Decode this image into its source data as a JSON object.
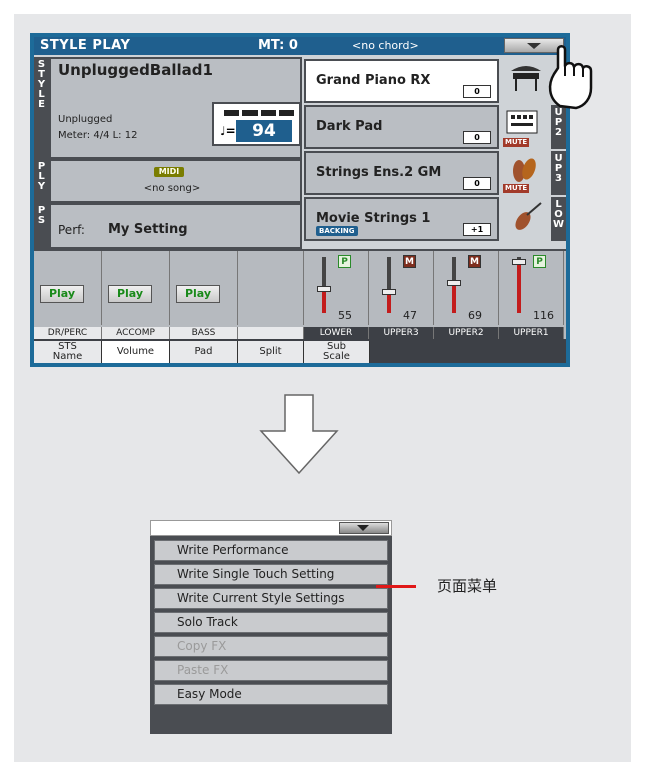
{
  "display": {
    "mode_title": "STYLE PLAY",
    "mt": "MT: 0",
    "chord": "<no chord>",
    "style": {
      "tab": "S\nT\nY\nL\nE",
      "name": "UnpluggedBallad1",
      "bank": "Unplugged",
      "meter": "Meter: 4/4  L: 12",
      "tempo_note": "♩=",
      "tempo": "94"
    },
    "player": {
      "tab": "P\nL\nY",
      "midi": "MIDI",
      "song": "<no song>"
    },
    "performance": {
      "tab": "P\nS",
      "label": "Perf:",
      "name": "My Setting"
    },
    "sounds": [
      {
        "name": "Grand Piano RX",
        "octave": "0",
        "side": "",
        "tag": "",
        "mute": ""
      },
      {
        "name": "Dark Pad",
        "octave": "0",
        "side": "U\nP\n2",
        "tag": "",
        "mute": "MUTE"
      },
      {
        "name": "Strings Ens.2 GM",
        "octave": "0",
        "side": "U\nP\n3",
        "tag": "",
        "mute": "MUTE"
      },
      {
        "name": "Movie Strings 1",
        "octave": "+1",
        "side": "L\nO\nW",
        "tag": "BACKING",
        "mute": ""
      }
    ],
    "mixer": {
      "channels": [
        {
          "label": "DR/PERC",
          "button": "Play"
        },
        {
          "label": "ACCOMP",
          "button": "Play"
        },
        {
          "label": "BASS",
          "button": "Play"
        },
        {
          "label": "",
          "button": ""
        }
      ],
      "keyboard": [
        {
          "label": "LOWER",
          "badge": "P",
          "volume": "55",
          "level": 0.43
        },
        {
          "label": "UPPER3",
          "badge": "M",
          "volume": "47",
          "level": 0.37
        },
        {
          "label": "UPPER2",
          "badge": "M",
          "volume": "69",
          "level": 0.54
        },
        {
          "label": "UPPER1",
          "badge": "P",
          "volume": "116",
          "level": 0.91
        }
      ]
    },
    "tabs": [
      "STS\nName",
      "Volume",
      "Pad",
      "Split",
      "Sub\nScale"
    ]
  },
  "menu": {
    "items": [
      {
        "label": "Write Performance",
        "enabled": true
      },
      {
        "label": "Write Single Touch Setting",
        "enabled": true
      },
      {
        "label": "Write Current Style Settings",
        "enabled": true
      },
      {
        "label": "Solo Track",
        "enabled": true
      },
      {
        "label": "Copy FX",
        "enabled": false
      },
      {
        "label": "Paste FX",
        "enabled": false
      },
      {
        "label": "Easy Mode",
        "enabled": true
      }
    ],
    "callout": "页面菜单"
  },
  "colors": {
    "title_blue": "#1f5f8e",
    "panel_bg": "#e6e7e9",
    "callout_red": "#e01818"
  }
}
